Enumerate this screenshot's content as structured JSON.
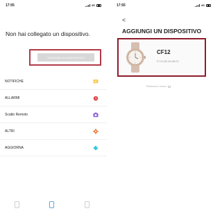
{
  "left_screen": {
    "status": {
      "time": "17:55",
      "network": "4G"
    },
    "title": "Non hai collegato un dispositivo.",
    "connect_button": "Aggiungi un dispositivo",
    "menu": [
      {
        "label": "NOTIFICHE",
        "icon": "message-icon",
        "color": "#f5c842"
      },
      {
        "label": "ALLARMI",
        "icon": "alarm-clock-icon",
        "color": "#e04848"
      },
      {
        "label": "Scatto Remoto",
        "icon": "camera-icon",
        "color": "#8a5ed6"
      },
      {
        "label": "ALTRI",
        "icon": "gear-icon",
        "color": "#f07a3a"
      },
      {
        "label": "AGGIORNA",
        "icon": "update-icon",
        "color": "#2cc4e0"
      }
    ],
    "tabbar": [
      "device-tab-icon",
      "watch-tab-icon",
      "profile-tab-icon"
    ]
  },
  "right_screen": {
    "status": {
      "time": "17:55",
      "network": "4G"
    },
    "back": "<",
    "title": "AGGIUNGI UN DISPOSITIVO",
    "device": {
      "name": "CF12",
      "mac": "E7:D0:8E:DD:6B:E5"
    },
    "searching": "Ricerca in corso"
  },
  "colors": {
    "highlight": "#b23a48",
    "device_highlight": "#8e1b2b",
    "active_tab": "#5ba7e6"
  }
}
